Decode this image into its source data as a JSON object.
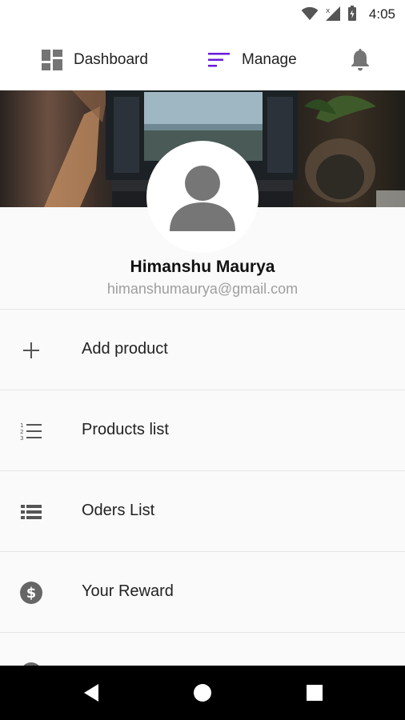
{
  "status_bar": {
    "time": "4:05"
  },
  "top_nav": {
    "dashboard_label": "Dashboard",
    "manage_label": "Manage",
    "accent_color": "#6a1bd9"
  },
  "profile": {
    "name": "Himanshu Maurya",
    "email": "himanshumaurya@gmail.com"
  },
  "menu": {
    "items": [
      {
        "label": "Add product",
        "icon": "plus-icon"
      },
      {
        "label": "Products list",
        "icon": "numbered-list-icon"
      },
      {
        "label": "Oders List",
        "icon": "list-icon"
      },
      {
        "label": "Your Reward",
        "icon": "dollar-circle-icon"
      }
    ]
  }
}
